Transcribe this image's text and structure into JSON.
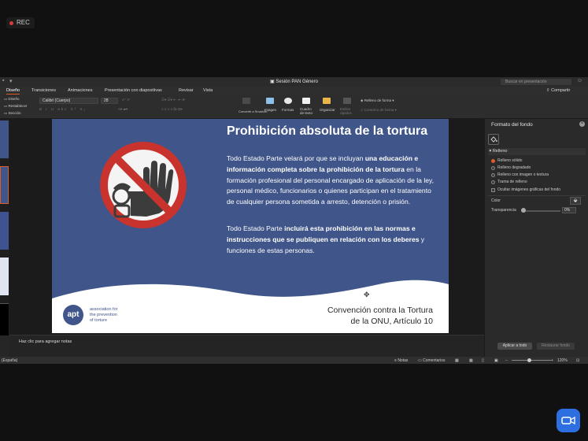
{
  "recording": {
    "label": "REC"
  },
  "window": {
    "title": "Sesión PAN Género",
    "search_placeholder": "Buscar en presentación"
  },
  "menu": {
    "tabs": [
      "Diseño",
      "Transiciones",
      "Animaciones",
      "Presentación con diapositivas",
      "Revisar",
      "Vista"
    ],
    "share": "Compartir"
  },
  "ribbon": {
    "diseno": "Diseño",
    "restablecer": "Restablecer",
    "seccion": "Sección",
    "font_name": "Calibri (Cuerpo)",
    "font_size": "28",
    "convertir": "Convertir a SmartArt",
    "imagen": "Imagen",
    "formas": "Formas",
    "cuadro_texto": "Cuadro de texto",
    "organizar": "Organizar",
    "estilos": "Estilos rápidos",
    "relleno_forma": "Relleno de forma",
    "contorno_forma": "Contorno de forma"
  },
  "slide": {
    "title": "Prohibición absoluta de la tortura",
    "para1": {
      "p1": "Todo Estado Parte velará por que se incluyan ",
      "b1": "una educación e información completa sobre la prohibición de la tortura",
      "p2": " en la formación profesional del personal encargado de aplicación de la ley, personal médico, funcionarios o quienes participan en el tratamiento de  cualquier persona sometida a arresto, detención o prisión."
    },
    "para2": {
      "p1": "Todo Estado Parte ",
      "b1": "incluirá esta prohibición en las normas e instrucciones que se publiquen en relación con los deberes",
      "p2": " y funciones de estas personas."
    },
    "citation_line1": "Convención contra la Tortura",
    "citation_line2": "de la ONU, Artículo 10",
    "logo_text": "apt",
    "org_line1": "association for",
    "org_line2": "the prevention",
    "org_line3": "of torture"
  },
  "notes": {
    "placeholder": "Haz clic para agregar notas"
  },
  "format_panel": {
    "title": "Formato del fondo",
    "section": "Relleno",
    "options": [
      "Relleno sólido",
      "Relleno degradado",
      "Relleno con imagen o textura",
      "Trama de relleno"
    ],
    "selected_option": "Relleno sólido",
    "hide_graphics": "Ocultar imágenes gráficas del fondo",
    "color_label": "Color",
    "transparency_label": "Transparencia",
    "transparency_value": "0%",
    "apply_all": "Aplicar a todo",
    "reset": "Restaurar fondo"
  },
  "status": {
    "language": "(España)",
    "notes": "Notas",
    "comments": "Comentarios",
    "zoom": "120%"
  },
  "colors": {
    "slide_blue": "#405589",
    "accent": "#e05b2c",
    "sign_red": "#c8332e",
    "zoom_blue": "#2d6fe0"
  }
}
